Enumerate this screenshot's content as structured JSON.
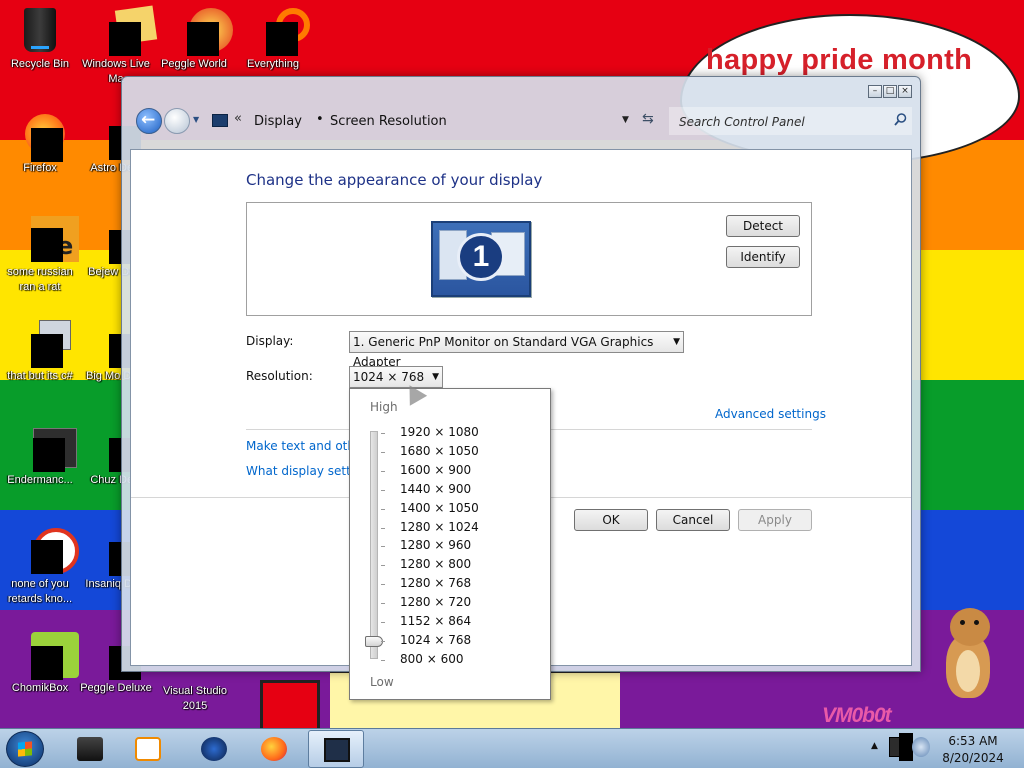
{
  "desktop": {
    "bubble_text": "happy pride month",
    "watermark": "VM0b0t",
    "icons": [
      {
        "label": "Recycle Bin"
      },
      {
        "label": "Windows Live Ma"
      },
      {
        "label": "Peggle World"
      },
      {
        "label": "Everything"
      },
      {
        "label": "Firefox"
      },
      {
        "label": "Astro Delu"
      },
      {
        "label": "some russian ran a rat"
      },
      {
        "label": "Bejew Delu"
      },
      {
        "label": "that but its c#"
      },
      {
        "label": "Big Mo Delu"
      },
      {
        "label": "Endermanc..."
      },
      {
        "label": "Chuz Delu"
      },
      {
        "label": "none of you retards kno..."
      },
      {
        "label": "Insaniq Delu"
      },
      {
        "label": "ChomikBox"
      },
      {
        "label": "Peggle Deluxe"
      },
      {
        "label": "Visual Studio 2015"
      }
    ]
  },
  "window": {
    "breadcrumb": {
      "sep0": "«",
      "display": "Display",
      "sep1": "•",
      "current": "Screen Resolution"
    },
    "search_placeholder": "Search Control Panel",
    "title": "Change the appearance of your display",
    "monitor_number": "1",
    "detect_label": "Detect",
    "identify_label": "Identify",
    "display_label": "Display:",
    "display_value": "1. Generic PnP Monitor on Standard VGA Graphics Adapter",
    "resolution_label": "Resolution:",
    "resolution_value": "1024 × 768",
    "advanced_link": "Advanced settings",
    "text_link": "Make text and other",
    "what_link": "What display setting",
    "ok_label": "OK",
    "cancel_label": "Cancel",
    "apply_label": "Apply"
  },
  "resolution_popup": {
    "high_label": "High",
    "low_label": "Low",
    "selected": "1024 × 768",
    "options": [
      "1920 × 1080",
      "1680 × 1050",
      "1600 × 900",
      "1440 × 900",
      "1400 × 1050",
      "1280 × 1024",
      "1280 × 960",
      "1280 × 800",
      "1280 × 768",
      "1280 × 720",
      "1152 × 864",
      "1024 × 768",
      "800 × 600"
    ]
  },
  "taskbar": {
    "clock_time": "6:53 AM",
    "clock_date": "8/20/2024"
  },
  "colors": {
    "link": "#0066cc",
    "title_blue": "#1e3287",
    "bubble_text": "#d6202a"
  }
}
